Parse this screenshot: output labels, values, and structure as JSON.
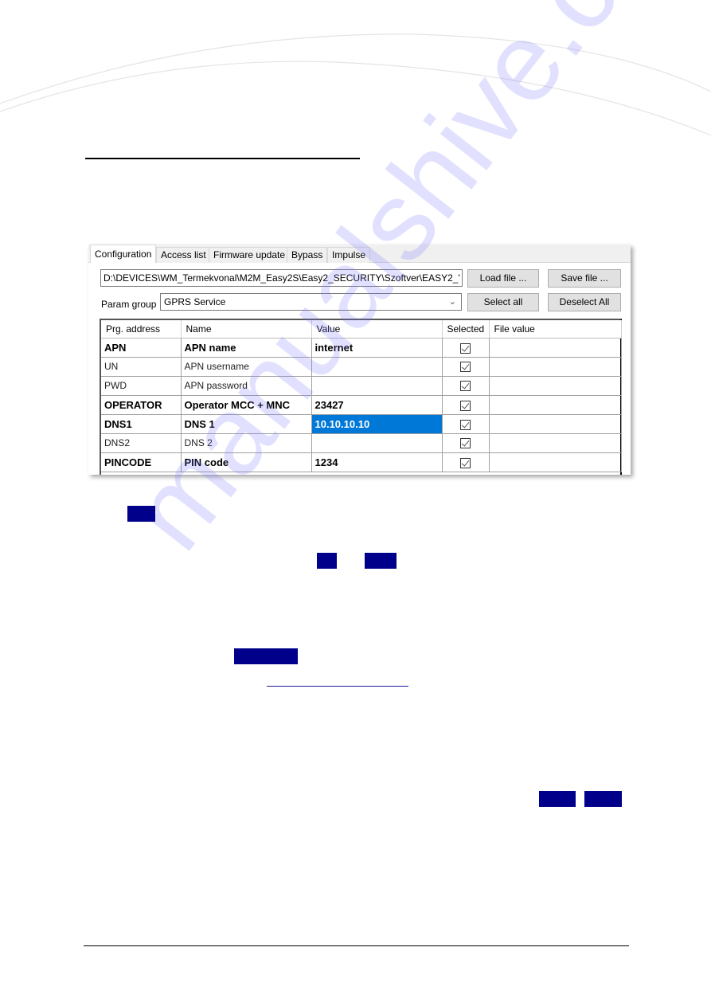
{
  "app": {
    "tabs": [
      {
        "label": "Configuration",
        "active": true
      },
      {
        "label": "Access list",
        "active": false
      },
      {
        "label": "Firmware update",
        "active": false
      },
      {
        "label": "Bypass",
        "active": false
      },
      {
        "label": "Impulse",
        "active": false
      }
    ],
    "file_path": "D:\\DEVICES\\WM_Termekvonal\\M2M_Easy2S\\Easy2_SECURITY\\Szoftver\\EASY2_'",
    "buttons": {
      "load_file": "Load file ...",
      "save_file": "Save file ...",
      "select_all": "Select all",
      "deselect_all": "Deselect All"
    },
    "param_group": {
      "label": "Param group",
      "selected": "GPRS Service",
      "chevron": "⌵"
    },
    "grid": {
      "columns": [
        "Prg. address",
        "Name",
        "Value",
        "Selected",
        "File value"
      ],
      "rows": [
        {
          "address": "APN",
          "name": "APN name",
          "value": "internet",
          "selected": true,
          "file_value": "",
          "bold": true
        },
        {
          "address": "UN",
          "name": "APN username",
          "value": "",
          "selected": true,
          "file_value": "",
          "bold": false
        },
        {
          "address": "PWD",
          "name": "APN password",
          "value": "",
          "selected": true,
          "file_value": "",
          "bold": false
        },
        {
          "address": "OPERATOR",
          "name": "Operator MCC + MNC",
          "value": "23427",
          "selected": true,
          "file_value": "",
          "bold": true
        },
        {
          "address": "DNS1",
          "name": "DNS 1",
          "value": "10.10.10.10",
          "selected": true,
          "file_value": "",
          "bold": true,
          "value_highlighted": true
        },
        {
          "address": "DNS2",
          "name": "DNS 2",
          "value": "",
          "selected": true,
          "file_value": "",
          "bold": false
        },
        {
          "address": "PINCODE",
          "name": "PIN code",
          "value": "1234",
          "selected": true,
          "file_value": "",
          "bold": true
        }
      ]
    },
    "selection_color": "#0078d7"
  },
  "document": {
    "highlight_color": "#00008b",
    "watermark": "manualshive.com"
  }
}
